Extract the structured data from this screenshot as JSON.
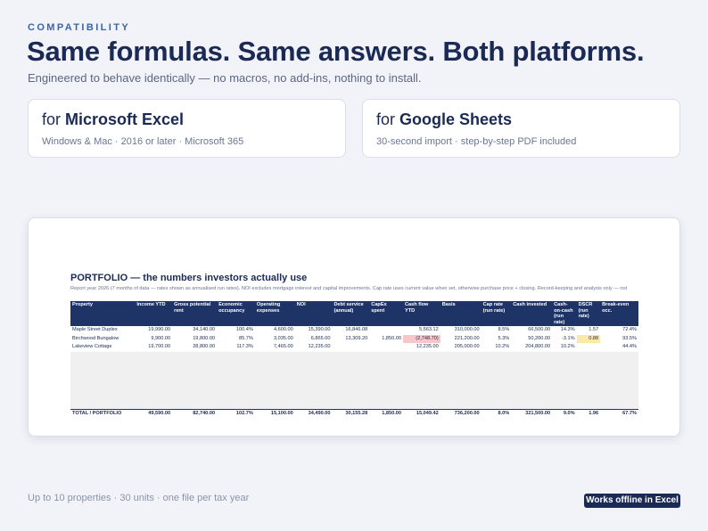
{
  "header": {
    "eyebrow": "COMPATIBILITY",
    "headline": "Same formulas. Same answers. Both platforms.",
    "subhead": "Engineered to behave identically — no macros, no add-ins, nothing to install."
  },
  "cards": {
    "excel": {
      "for": "for ",
      "brand": "Microsoft Excel",
      "sub": "Windows & Mac · 2016 or later · Microsoft 365"
    },
    "sheets": {
      "for": "for ",
      "brand": "Google Sheets",
      "sub": "30-second import · step-by-step PDF included"
    }
  },
  "sheet": {
    "title": "PORTFOLIO — the numbers investors actually use",
    "note": "Report year 2026 (7 months of data — rates shown as annualised run rates). NOI excludes mortgage interest and capital improvements. Cap rate uses current value when set, otherwise purchase price + closing. Record-keeping and analysis only — not",
    "columns": [
      "Property",
      "Income YTD",
      "Gross potential rent",
      "Economic occupancy",
      "Operating expenses",
      "NOI",
      "Debt service (annual)",
      "CapEx spent",
      "Cash flow YTD",
      "Basis",
      "Cap rate (run rate)",
      "Cash invested",
      "Cash-on-cash (run rate)",
      "DSCR (run rate)",
      "Break-even occ."
    ],
    "rows": [
      [
        "Maple Street Duplex",
        "19,990.00",
        "34,140.00",
        "100.4%",
        "4,600.00",
        "15,390.00",
        "16,846.08",
        "",
        "5,563.12",
        "310,000.00",
        "8.5%",
        "66,500.00",
        "14.3%",
        "1.57",
        "72.4%"
      ],
      [
        "Birchwood Bungalow",
        "9,900.00",
        "19,800.00",
        "85.7%",
        "3,035.00",
        "6,865.00",
        "13,309.20",
        "1,850.00",
        "(2,748.70)",
        "221,200.00",
        "5.3%",
        "50,200.00",
        "-3.1%",
        "0.88",
        "93.5%"
      ],
      [
        "Lakeview Cottage",
        "19,700.00",
        "28,800.00",
        "117.3%",
        "7,465.00",
        "12,235.00",
        "",
        "",
        "12,235.00",
        "205,000.00",
        "10.2%",
        "204,800.00",
        "10.2%",
        "",
        "44.4%"
      ]
    ],
    "total": [
      "TOTAL / PORTFOLIO",
      "49,590.00",
      "82,740.00",
      "102.7%",
      "15,100.00",
      "34,490.00",
      "30,155.28",
      "1,850.00",
      "15,049.42",
      "736,200.00",
      "8.0%",
      "321,500.00",
      "9.0%",
      "1.96",
      "67.7%"
    ],
    "colors": {
      "header_bg": "#1e3366",
      "negative_fill": "#f6c6c8",
      "warning_fill": "#fbeaa5"
    }
  },
  "footer": {
    "note": "Up to 10 properties · 30 units · one file per tax year",
    "badge": "Works offline in Excel"
  }
}
